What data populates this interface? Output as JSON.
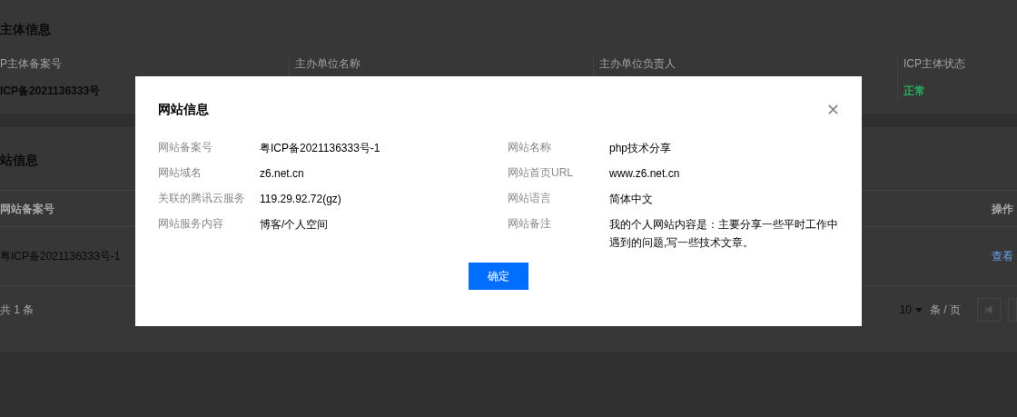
{
  "subject_section": {
    "title": "主体信息",
    "columns": [
      {
        "header": "P主体备案号",
        "value": "ICP备2021136333号",
        "kind": "bold"
      },
      {
        "header": "主办单位名称"
      },
      {
        "header": "主办单位负责人"
      },
      {
        "header": "ICP主体状态",
        "value": "正常",
        "kind": "status"
      }
    ]
  },
  "site_section": {
    "title": "站信息",
    "table": {
      "columns": [
        "网站备案号",
        "操作"
      ],
      "rows": [
        {
          "record_no": "粤ICP备2021136333号-1",
          "action": "查看"
        }
      ]
    },
    "footer": {
      "total": "共 1 条",
      "page_size": "10",
      "page_size_unit": "条 / 页"
    }
  },
  "dialog": {
    "title": "网站信息",
    "close": "✕",
    "left": [
      {
        "label": "网站备案号",
        "value": "粤ICP备2021136333号-1"
      },
      {
        "label": "网站域名",
        "value": "z6.net.cn"
      },
      {
        "label": "关联的腾讯云服务",
        "value": "119.29.92.72(gz)"
      },
      {
        "label": "网站服务内容",
        "value": "博客/个人空间"
      }
    ],
    "right": [
      {
        "label": "网站名称",
        "value": "php技术分享"
      },
      {
        "label": "网站首页URL",
        "value": "www.z6.net.cn"
      },
      {
        "label": "网站语言",
        "value": "简体中文"
      },
      {
        "label": "网站备注",
        "value": "我的个人网站内容是：主要分享一些平时工作中遇到的问题,写一些技术文章。"
      }
    ],
    "confirm": "确定"
  }
}
